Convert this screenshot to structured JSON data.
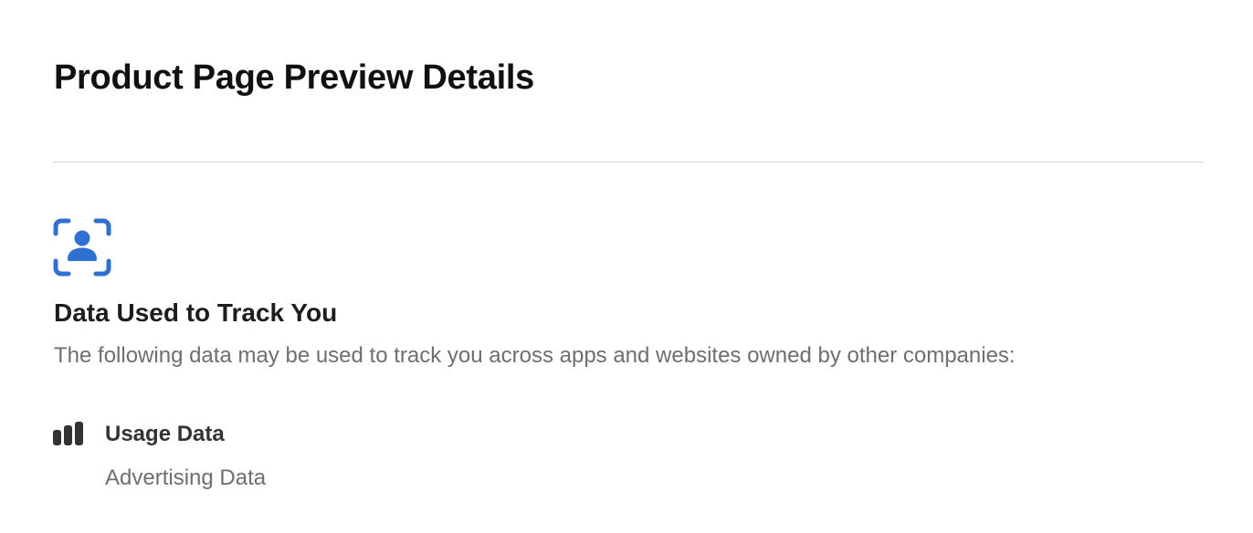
{
  "header": {
    "title": "Product Page Preview Details"
  },
  "privacy_section": {
    "icon": "tracking-person-icon",
    "title": "Data Used to Track You",
    "description": "The following data may be used to track you across apps and websites owned by other companies:",
    "categories": [
      {
        "icon": "usage-data-bars-icon",
        "title": "Usage Data",
        "items": [
          "Advertising Data"
        ]
      }
    ]
  },
  "colors": {
    "accent_blue": "#2f70d3",
    "title_text": "#111111",
    "secondary_text": "#6e6e73",
    "divider": "#d2d2d7"
  }
}
